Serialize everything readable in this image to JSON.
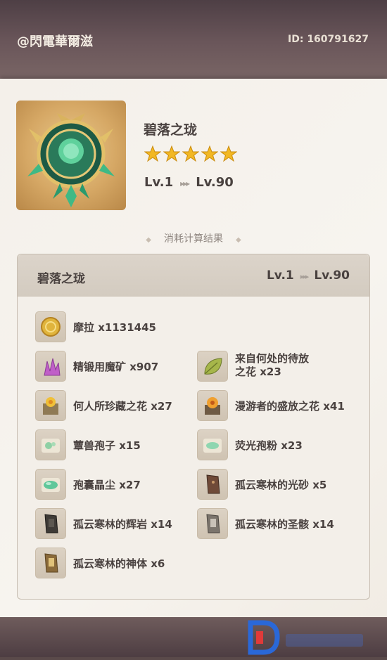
{
  "header": {
    "user": "@閃電華爾滋",
    "uid": "ID: 160791627"
  },
  "weapon": {
    "name": "碧落之珑",
    "stars": 5,
    "lv_from": "Lv.1",
    "lv_to": "Lv.90",
    "arrows": "▸▸▸"
  },
  "section": {
    "title": "消耗计算结果",
    "diamond": "◆"
  },
  "result": {
    "name": "碧落之珑",
    "lv_from": "Lv.1",
    "lv_to": "Lv.90",
    "arrows": "▸▸▸"
  },
  "materials": [
    {
      "icon": "mora-icon",
      "name": "摩拉 x1131445"
    },
    {
      "icon": "mystic-ore-icon",
      "name": "精锻用魔矿 x907"
    },
    {
      "icon": "leaf-icon",
      "name": "来自何处的待放",
      "name2": "之花 x23"
    },
    {
      "icon": "treasured-flower-icon",
      "name": "何人所珍藏之花 x27"
    },
    {
      "icon": "blooming-flower-icon",
      "name": "漫游者的盛放之花 x41"
    },
    {
      "icon": "spore-icon",
      "name": "蕈兽孢子 x15"
    },
    {
      "icon": "luminescent-pollen-icon",
      "name": "荧光孢粉 x23"
    },
    {
      "icon": "crystalline-dust-icon",
      "name": "孢囊晶尘 x27"
    },
    {
      "icon": "sand-icon",
      "name": "孤云寒林的光砂 x5"
    },
    {
      "icon": "radiant-rock-icon",
      "name": "孤云寒林的辉岩 x14"
    },
    {
      "icon": "relic-icon",
      "name": "孤云寒林的圣骸 x14"
    },
    {
      "icon": "divine-body-icon",
      "name": "孤云寒林的神体 x6"
    }
  ],
  "colors": {
    "star": "#f2b824",
    "text": "#4a4240",
    "accent": "#2fa37a"
  }
}
